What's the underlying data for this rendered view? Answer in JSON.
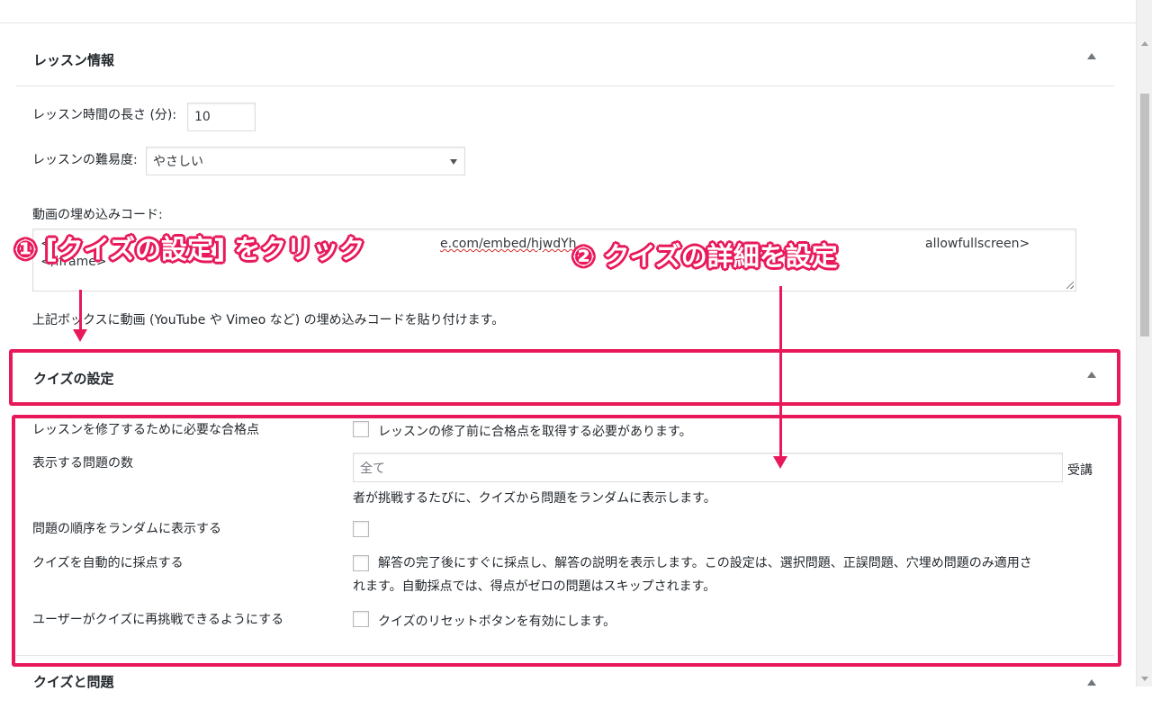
{
  "lesson_info": {
    "title": "レッスン情報",
    "length_label": "レッスン時間の長さ (分):",
    "length_value": "10",
    "difficulty_label": "レッスンの難易度:",
    "difficulty_value": "やさしい",
    "embed_label": "動画の埋め込みコード:",
    "embed_line1_a": "<i",
    "embed_line1_b": "e.com/embed/hjwdYh",
    "embed_line1_c": "allowfullscreen>",
    "embed_line2": "</iframe>",
    "embed_help": "上記ボックスに動画 (YouTube や Vimeo など) の埋め込みコードを貼り付けます。"
  },
  "quiz_settings": {
    "title": "クイズの設定",
    "pass_label": "レッスンを修了するために必要な合格点",
    "pass_desc": "レッスンの修了前に合格点を取得する必要があります。",
    "num_questions_label": "表示する問題の数",
    "num_questions_value": "全て",
    "num_questions_suffix": "受講",
    "num_questions_desc": "者が挑戦するたびに、クイズから問題をランダムに表示します。",
    "random_order_label": "問題の順序をランダムに表示する",
    "auto_grade_label": "クイズを自動的に採点する",
    "auto_grade_desc_1": "解答の完了後にすぐに採点し、解答の説明を表示します。この設定は、選択問題、正誤問題、穴埋め問題のみ適用さ",
    "auto_grade_desc_2": "れます。自動採点では、得点がゼロの問題はスキップされます。",
    "retry_label": "ユーザーがクイズに再挑戦できるようにする",
    "retry_desc": "クイズのリセットボタンを有効にします。"
  },
  "quiz_questions": {
    "title": "クイズと問題"
  },
  "annotations": {
    "step1": "① [クイズの設定] をクリック",
    "step2": "② クイズの詳細を設定",
    "color": "#e8195a"
  }
}
